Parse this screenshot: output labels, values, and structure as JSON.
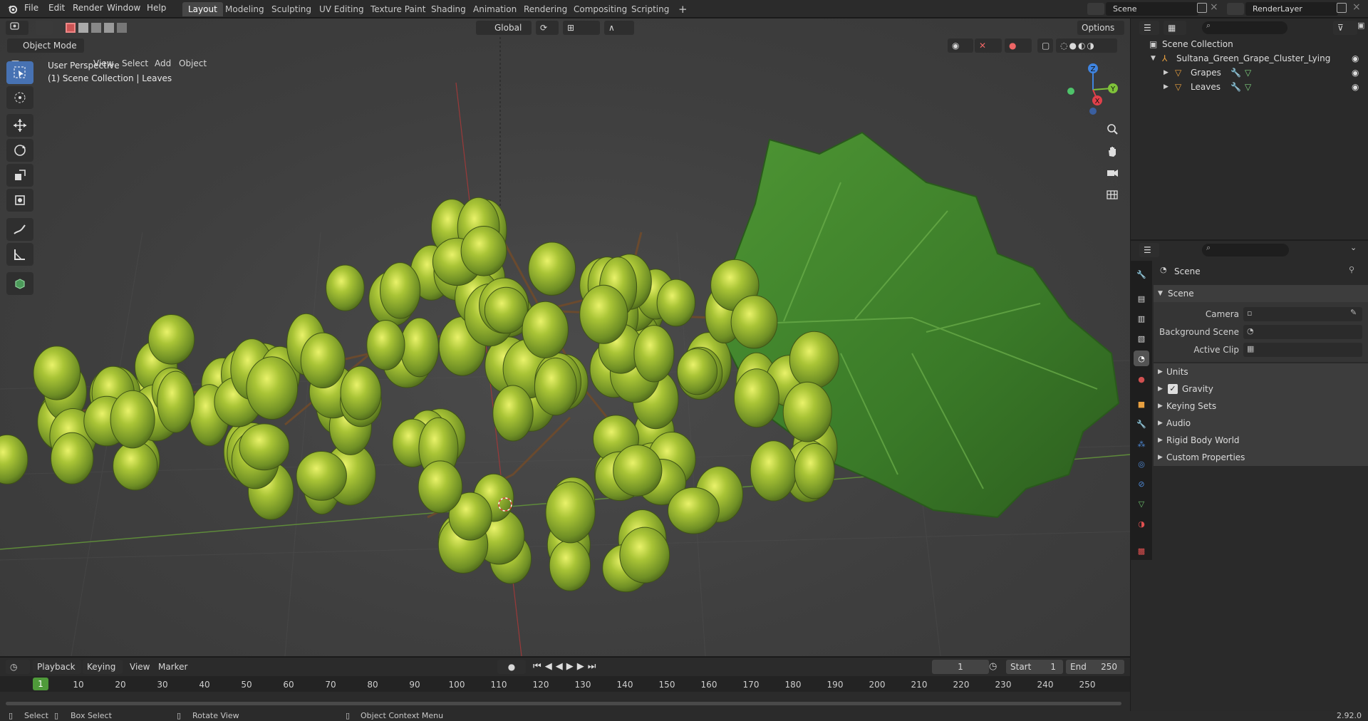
{
  "top_menu": [
    "File",
    "Edit",
    "Render",
    "Window",
    "Help"
  ],
  "workspaces": [
    "Layout",
    "Modeling",
    "Sculpting",
    "UV Editing",
    "Texture Paint",
    "Shading",
    "Animation",
    "Rendering",
    "Compositing",
    "Scripting"
  ],
  "active_workspace": "Layout",
  "add_workspace": "+",
  "scene_field": "Scene",
  "view_layer_field": "RenderLayer",
  "viewport": {
    "mode": "Object Mode",
    "menus": [
      "View",
      "Select",
      "Add",
      "Object"
    ],
    "orientation": "Global",
    "options": "Options",
    "perspective_label": "User Perspective",
    "collection_label": "(1) Scene Collection | Leaves",
    "gizmo_axes": [
      "Z",
      "Y",
      "X"
    ]
  },
  "timeline": {
    "menus": [
      "Playback",
      "Keying",
      "View",
      "Marker"
    ],
    "current_frame": "1",
    "start_label": "Start",
    "start": "1",
    "end_label": "End",
    "end": "250",
    "playhead": "1",
    "ticks": [
      "10",
      "20",
      "30",
      "40",
      "50",
      "60",
      "70",
      "80",
      "90",
      "100",
      "110",
      "120",
      "130",
      "140",
      "150",
      "160",
      "170",
      "180",
      "190",
      "200",
      "210",
      "220",
      "230",
      "240",
      "250"
    ]
  },
  "status_bar": {
    "select": "Select",
    "box_select": "Box Select",
    "rotate_view": "Rotate View",
    "context_menu": "Object Context Menu",
    "version": "2.92.0"
  },
  "outliner": {
    "root": "Scene Collection",
    "collection": "Sultana_Green_Grape_Cluster_Lying",
    "objects": [
      "Grapes",
      "Leaves"
    ]
  },
  "properties": {
    "context": "Scene",
    "panel_title": "Scene",
    "fields": [
      {
        "label": "Camera"
      },
      {
        "label": "Background Scene"
      },
      {
        "label": "Active Clip"
      }
    ],
    "subpanels": [
      "Units",
      "Gravity",
      "Keying Sets",
      "Audio",
      "Rigid Body World",
      "Custom Properties"
    ],
    "gravity_checked": true
  },
  "colors": {
    "accent": "#4772b3",
    "leaf": "#3d7a2a",
    "grape": "#9fbf2d",
    "axis_x": "#e0404a",
    "axis_y": "#7fc23a",
    "axis_z": "#3f84e0"
  }
}
